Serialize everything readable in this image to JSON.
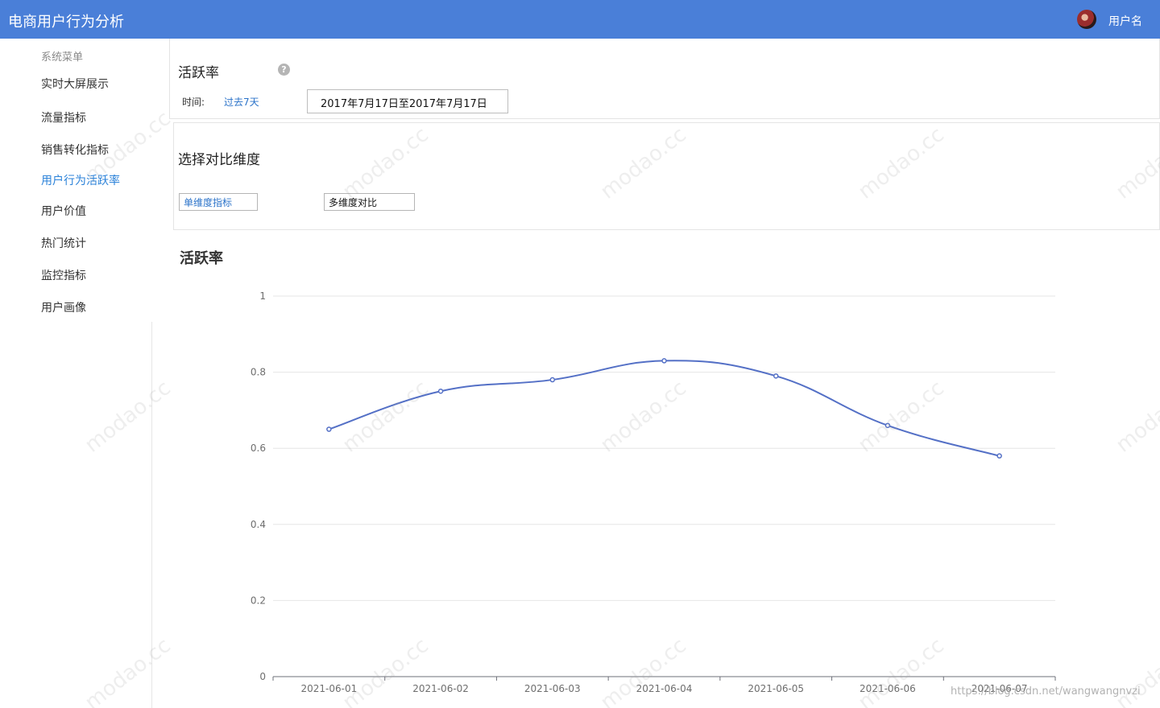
{
  "app": {
    "title": "电商用户行为分析",
    "username": "用户名"
  },
  "sidebar": {
    "heading": "系统菜单",
    "items": [
      {
        "label": "实时大屏展示",
        "active": false
      },
      {
        "label": "流量指标",
        "active": false
      },
      {
        "label": "销售转化指标",
        "active": false
      },
      {
        "label": "用户行为活跃率",
        "active": true
      },
      {
        "label": "用户价值",
        "active": false
      },
      {
        "label": "热门统计",
        "active": false
      },
      {
        "label": "监控指标",
        "active": false
      },
      {
        "label": "用户画像",
        "active": false
      }
    ]
  },
  "filter": {
    "title": "活跃率",
    "help_icon": "?",
    "time_label": "时间:",
    "time_link": "过去7天",
    "date_range": "2017年7月17日至2017年7月17日"
  },
  "compare": {
    "title": "选择对比维度",
    "single_label": "单维度指标",
    "multi_label": "多维度对比"
  },
  "chart_data": {
    "type": "line",
    "title": "活跃率",
    "smooth": true,
    "categories": [
      "2021-06-01",
      "2021-06-02",
      "2021-06-03",
      "2021-06-04",
      "2021-06-05",
      "2021-06-06",
      "2021-06-07"
    ],
    "series": [
      {
        "values": [
          0.65,
          0.75,
          0.78,
          0.83,
          0.79,
          0.66,
          0.58
        ],
        "color": "#5470c6"
      }
    ],
    "ylim": [
      0,
      1
    ],
    "yticks": [
      0,
      0.2,
      0.4,
      0.6,
      0.8,
      1
    ],
    "ytick_labels": [
      "0",
      "0.2",
      "0.4",
      "0.6",
      "0.8",
      "1"
    ],
    "grid": true
  },
  "watermark": "modao.cc",
  "credit": "https://blog.csdn.net/wangwangnvzi",
  "colors": {
    "header": "#4a7fd8",
    "accent": "#2b82d9",
    "line": "#5470c6"
  }
}
